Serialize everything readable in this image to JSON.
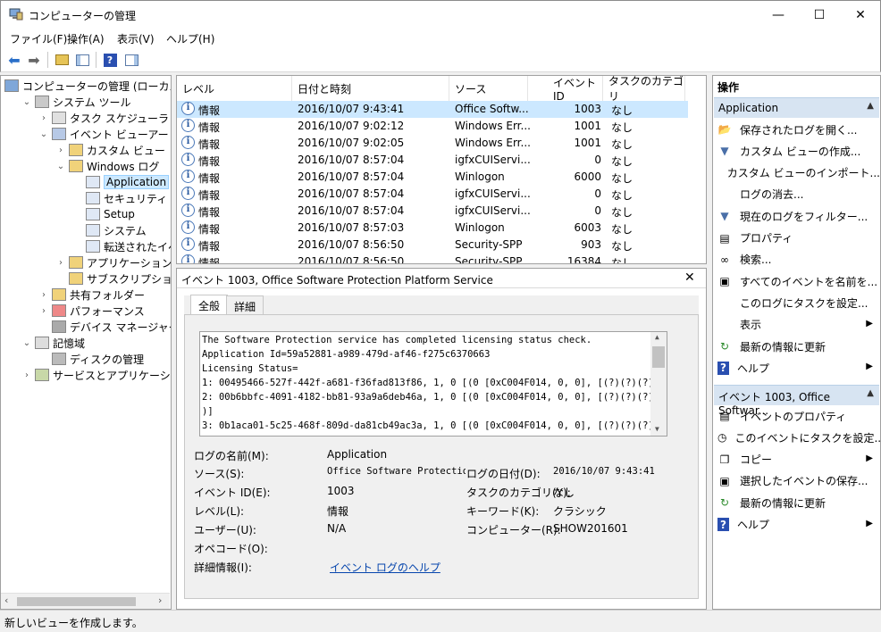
{
  "window": {
    "title": "コンピューターの管理"
  },
  "menu": [
    "ファイル(F)",
    "操作(A)",
    "表示(V)",
    "ヘルプ(H)"
  ],
  "tree": [
    {
      "label": "コンピューターの管理 (ローカル)",
      "level": 0,
      "exp": "",
      "icon": "computer-management-icon"
    },
    {
      "label": "システム ツール",
      "level": 1,
      "exp": "v",
      "icon": "system-tools-icon"
    },
    {
      "label": "タスク スケジューラ",
      "level": 2,
      "exp": ">",
      "icon": "task-scheduler-icon"
    },
    {
      "label": "イベント ビューアー",
      "level": 2,
      "exp": "v",
      "icon": "event-viewer-icon"
    },
    {
      "label": "カスタム ビュー",
      "level": 3,
      "exp": ">",
      "icon": "folder-icon"
    },
    {
      "label": "Windows ログ",
      "level": 3,
      "exp": "v",
      "icon": "folder-icon"
    },
    {
      "label": "Application",
      "level": 4,
      "exp": "",
      "icon": "log-icon",
      "selected": true
    },
    {
      "label": "セキュリティ",
      "level": 4,
      "exp": "",
      "icon": "log-icon"
    },
    {
      "label": "Setup",
      "level": 4,
      "exp": "",
      "icon": "log-icon"
    },
    {
      "label": "システム",
      "level": 4,
      "exp": "",
      "icon": "log-icon"
    },
    {
      "label": "転送されたイベント",
      "level": 4,
      "exp": "",
      "icon": "log-icon"
    },
    {
      "label": "アプリケーションとサービ",
      "level": 3,
      "exp": ">",
      "icon": "folder-icon"
    },
    {
      "label": "サブスクリプション",
      "level": 3,
      "exp": "",
      "icon": "subscription-icon"
    },
    {
      "label": "共有フォルダー",
      "level": 2,
      "exp": ">",
      "icon": "shared-folders-icon"
    },
    {
      "label": "パフォーマンス",
      "level": 2,
      "exp": ">",
      "icon": "performance-icon"
    },
    {
      "label": "デバイス マネージャー",
      "level": 2,
      "exp": "",
      "icon": "device-manager-icon"
    },
    {
      "label": "記憶域",
      "level": 1,
      "exp": "v",
      "icon": "storage-icon"
    },
    {
      "label": "ディスクの管理",
      "level": 2,
      "exp": "",
      "icon": "disk-management-icon"
    },
    {
      "label": "サービスとアプリケーション",
      "level": 1,
      "exp": ">",
      "icon": "services-icon"
    }
  ],
  "grid": {
    "headers": [
      "レベル",
      "日付と時刻",
      "ソース",
      "イベント ID",
      "タスクのカテゴリ"
    ],
    "rows": [
      [
        "情報",
        "2016/10/07 9:43:41",
        "Office Softw...",
        "1003",
        "なし"
      ],
      [
        "情報",
        "2016/10/07 9:02:12",
        "Windows Err...",
        "1001",
        "なし"
      ],
      [
        "情報",
        "2016/10/07 9:02:05",
        "Windows Err...",
        "1001",
        "なし"
      ],
      [
        "情報",
        "2016/10/07 8:57:04",
        "igfxCUIServi...",
        "0",
        "なし"
      ],
      [
        "情報",
        "2016/10/07 8:57:04",
        "Winlogon",
        "6000",
        "なし"
      ],
      [
        "情報",
        "2016/10/07 8:57:04",
        "igfxCUIServi...",
        "0",
        "なし"
      ],
      [
        "情報",
        "2016/10/07 8:57:04",
        "igfxCUIServi...",
        "0",
        "なし"
      ],
      [
        "情報",
        "2016/10/07 8:57:03",
        "Winlogon",
        "6003",
        "なし"
      ],
      [
        "情報",
        "2016/10/07 8:56:50",
        "Security-SPP",
        "903",
        "なし"
      ],
      [
        "情報",
        "2016/10/07 8:56:50",
        "Security-SPP",
        "16384",
        "なし"
      ]
    ]
  },
  "detail": {
    "title": "イベント 1003, Office Software Protection Platform Service",
    "tabs": [
      "全般",
      "詳細"
    ],
    "message": [
      "The Software Protection service has completed licensing status check.",
      "Application Id=59a52881-a989-479d-af46-f275c6370663",
      "Licensing Status=",
      "1: 00495466-527f-442f-a681-f36fad813f86, 1, 0 [(0 [0xC004F014, 0, 0], [(?)(?)(?)(?)(?)(?)(1 )(2 )]",
      "2: 00b6bbfc-4091-4182-bb81-93a9a6deb46a, 1, 0 [(0 [0xC004F014, 0, 0], [(?)(?)(?)(?)(?)(?)(1 )(2",
      ")]",
      "3: 0b1aca01-5c25-468f-809d-da81cb49ac3a, 1, 0 [(0 [0xC004F014, 0, 0], [(?)(?)(?)(?)(?)(?)(1 )(2"
    ],
    "fields": {
      "logname_label": "ログの名前(M):",
      "logname": "Application",
      "source_label": "ソース(S):",
      "source": "Office Software Protection Pl",
      "logged_label": "ログの日付(D):",
      "logged": "2016/10/07 9:43:41",
      "eventid_label": "イベント ID(E):",
      "eventid": "1003",
      "category_label": "タスクのカテゴリ(Y):",
      "category": "なし",
      "level_label": "レベル(L):",
      "level": "情報",
      "keywords_label": "キーワード(K):",
      "keywords": "クラシック",
      "user_label": "ユーザー(U):",
      "user": "N/A",
      "computer_label": "コンピューター(R):",
      "computer": "SHOW201601",
      "opcode_label": "オペコード(O):",
      "moreinfo_label": "詳細情報(I):",
      "moreinfo_link": "イベント ログのヘルプ"
    }
  },
  "actions": {
    "header": "操作",
    "section1": "Application",
    "items1": [
      {
        "label": "保存されたログを開く...",
        "icon": "open-folder-icon",
        "g": "📂"
      },
      {
        "label": "カスタム ビューの作成...",
        "icon": "filter-icon",
        "g": "▼"
      },
      {
        "label": "カスタム ビューのインポート...",
        "icon": "",
        "g": ""
      },
      {
        "label": "ログの消去...",
        "icon": "",
        "g": ""
      },
      {
        "label": "現在のログをフィルター...",
        "icon": "filter-icon",
        "g": "▼"
      },
      {
        "label": "プロパティ",
        "icon": "properties-icon",
        "g": "▤"
      },
      {
        "label": "検索...",
        "icon": "binoculars-icon",
        "g": "∞"
      },
      {
        "label": "すべてのイベントを名前を...",
        "icon": "save-icon",
        "g": "▣"
      },
      {
        "label": "このログにタスクを設定...",
        "icon": "",
        "g": ""
      },
      {
        "label": "表示",
        "icon": "",
        "g": "",
        "arrow": true
      },
      {
        "label": "最新の情報に更新",
        "icon": "refresh-icon",
        "g": "↻"
      },
      {
        "label": "ヘルプ",
        "icon": "help-icon",
        "g": "?",
        "arrow": true
      }
    ],
    "section2": "イベント 1003, Office Softwar...",
    "items2": [
      {
        "label": "イベントのプロパティ",
        "icon": "properties-icon",
        "g": "▤"
      },
      {
        "label": "このイベントにタスクを設定...",
        "icon": "task-icon",
        "g": "◷"
      },
      {
        "label": "コピー",
        "icon": "copy-icon",
        "g": "❐",
        "arrow": true
      },
      {
        "label": "選択したイベントの保存...",
        "icon": "save-icon",
        "g": "▣"
      },
      {
        "label": "最新の情報に更新",
        "icon": "refresh-icon",
        "g": "↻"
      },
      {
        "label": "ヘルプ",
        "icon": "help-icon",
        "g": "?",
        "arrow": true
      }
    ]
  },
  "status": "新しいビューを作成します。",
  "colors": {
    "selection": "#cce8ff",
    "section": "#d7e4f2",
    "link": "#0645ad"
  }
}
